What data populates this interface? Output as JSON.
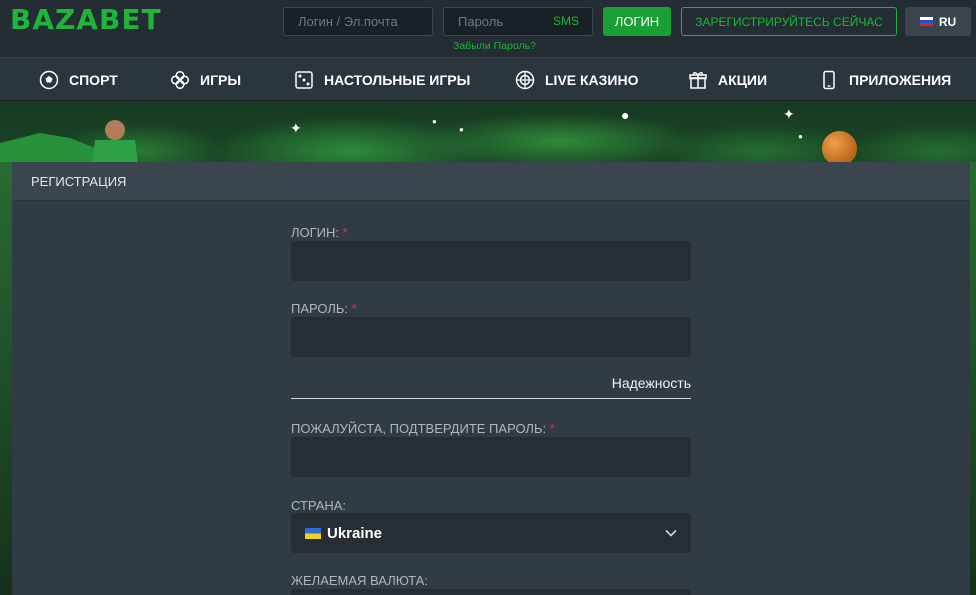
{
  "header": {
    "logo": "BAZABET",
    "login_placeholder": "Логин / Эл.почта",
    "password_placeholder": "Пароль",
    "sms_label": "SMS",
    "forgot_password": "Забыли Пароль?",
    "login_button": "ЛОГИН",
    "register_button": "ЗАРЕГИСТРИРУЙТЕСЬ СЕЙЧАС",
    "language": "RU"
  },
  "nav": {
    "items": [
      {
        "label": "СПОРТ",
        "icon": "soccer-ball-icon"
      },
      {
        "label": "ИГРЫ",
        "icon": "clover-icon"
      },
      {
        "label": "НАСТОЛЬНЫЕ ИГРЫ",
        "icon": "dice-icon"
      },
      {
        "label": "LIVE КАЗИНО",
        "icon": "target-icon"
      },
      {
        "label": "АКЦИИ",
        "icon": "gift-icon"
      },
      {
        "label": "ПРИЛОЖЕНИЯ",
        "icon": "mobile-phone-icon"
      }
    ]
  },
  "registration": {
    "title": "РЕГИСТРАЦИЯ",
    "login_label": "ЛОГИН:",
    "password_label": "ПАРОЛЬ:",
    "strength_label": "Надежность",
    "confirm_password_label": "ПОЖАЛУЙСТА, ПОДТВЕРДИТЕ ПАРОЛЬ:",
    "country_label": "СТРАНА:",
    "country_value": "Ukraine",
    "currency_label": "ЖЕЛАЕМАЯ ВАЛЮТА:",
    "required_mark": "*"
  },
  "colors": {
    "brand_green": "#1eb53a",
    "required_red": "#e0363d"
  }
}
